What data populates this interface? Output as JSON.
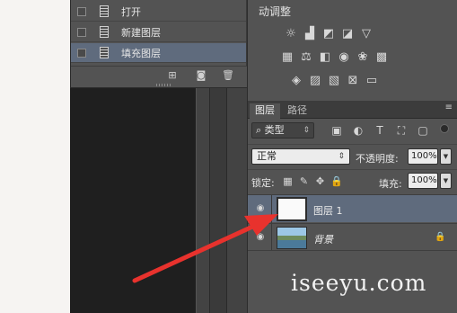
{
  "menu": {
    "items": [
      {
        "label": "打开"
      },
      {
        "label": "新建图层"
      },
      {
        "label": "填充图层"
      }
    ],
    "footer_icons": [
      "new-action-icon",
      "camera-icon",
      "trash-icon"
    ]
  },
  "adjustments": {
    "title": "动调整"
  },
  "layers_panel": {
    "tabs": [
      {
        "label": "图层"
      },
      {
        "label": "路径"
      }
    ],
    "filter": {
      "kind_label": "类型",
      "icons": [
        "image-icon",
        "circle-icon",
        "text-icon",
        "transform-icon",
        "smart-object-icon"
      ]
    },
    "blend_mode": "正常",
    "opacity_label": "不透明度:",
    "opacity_value": "100%",
    "lock_label": "锁定:",
    "fill_label": "填充:",
    "fill_value": "100%",
    "layers": [
      {
        "name": "图层 1",
        "selected": true
      },
      {
        "name": "背景",
        "selected": false,
        "locked": true
      }
    ]
  },
  "watermark": "iseeyu.com",
  "colors": {
    "panel": "#535353",
    "selection": "#5f6b7d",
    "arrow": "#e8322d"
  }
}
